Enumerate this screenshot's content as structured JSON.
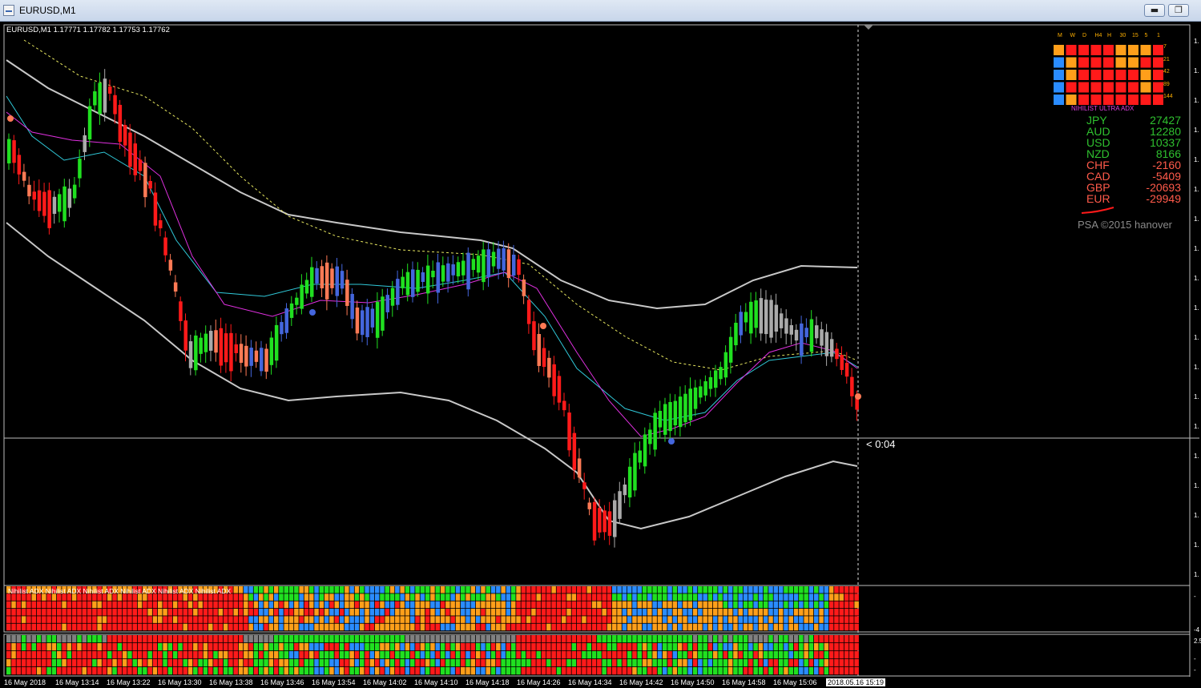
{
  "window": {
    "title": "EURUSD,M1",
    "minimize_label": "▬",
    "restore_label": "❐",
    "close_label": "✕"
  },
  "chart_header": "EURUSD,M1  1.17771 1.17782 1.17753 1.17762",
  "timer": "< 0:04",
  "indicator_label": "Nihilist  ADX  Nihilist  ADX  Nihilist  ADX  Nihilist  ADX  Nihilist  ADX  Nihilist  ADX",
  "matrix": {
    "timeframes": [
      "M",
      "W",
      "D",
      "H4",
      "H",
      "30",
      "15",
      "5",
      "1"
    ],
    "periods": [
      "7",
      "21",
      "42",
      "89",
      "144"
    ],
    "title": "NIHILIST ULTRA ADX",
    "colors": {
      "red": "#ff1a1a",
      "orange": "#ff9f1a",
      "blue": "#2a8cff",
      "green": "#20e020"
    }
  },
  "currency_strength": [
    {
      "name": "JPY",
      "value": "27427",
      "color": "#2fc12f"
    },
    {
      "name": "AUD",
      "value": "12280",
      "color": "#2fc12f"
    },
    {
      "name": "USD",
      "value": "10337",
      "color": "#2fc12f"
    },
    {
      "name": "NZD",
      "value": "8166",
      "color": "#2fc12f"
    },
    {
      "name": "CHF",
      "value": "-2160",
      "color": "#ff5a4a"
    },
    {
      "name": "CAD",
      "value": "-5409",
      "color": "#ff5a4a"
    },
    {
      "name": "GBP",
      "value": "-20693",
      "color": "#ff5a4a"
    },
    {
      "name": "EUR",
      "value": "-29949",
      "color": "#ff5a4a"
    }
  ],
  "copyright": "PSA ©2015 hanover",
  "time_axis": [
    "16 May 2018",
    "16 May 13:14",
    "16 May 13:22",
    "16 May 13:30",
    "16 May 13:38",
    "16 May 13:46",
    "16 May 13:54",
    "16 May 14:02",
    "16 May 14:10",
    "16 May 14:18",
    "16 May 14:26",
    "16 May 14:34",
    "16 May 14:42",
    "16 May 14:50",
    "16 May 14:58",
    "16 May 15:06"
  ],
  "current_time_label": "2018.05.16 15:19",
  "price_axis": {
    "tick_label": "1.",
    "indicator_ticks": [
      "-",
      "-4",
      "2.5",
      "-",
      "-"
    ]
  }
}
